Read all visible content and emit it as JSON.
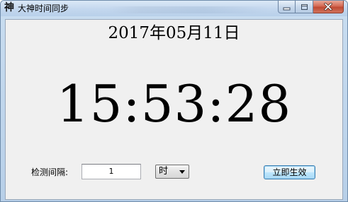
{
  "window": {
    "app_icon_glyph": "神",
    "title": "大神时间同步"
  },
  "caption_buttons": {
    "minimize_icon": "minimize-icon",
    "maximize_icon": "maximize-icon",
    "close_icon": "close-icon"
  },
  "clock": {
    "date": "2017年05月11日",
    "time": "15:53:28"
  },
  "settings": {
    "interval_label": "检测间隔:",
    "interval_value": "1",
    "unit_selected": "时",
    "apply_label": "立即生效"
  },
  "colors": {
    "frame": "#c9ddf0",
    "client_bg": "#f0f0f0",
    "close_button": "#c04a33",
    "apply_button": "#bee6fd"
  }
}
